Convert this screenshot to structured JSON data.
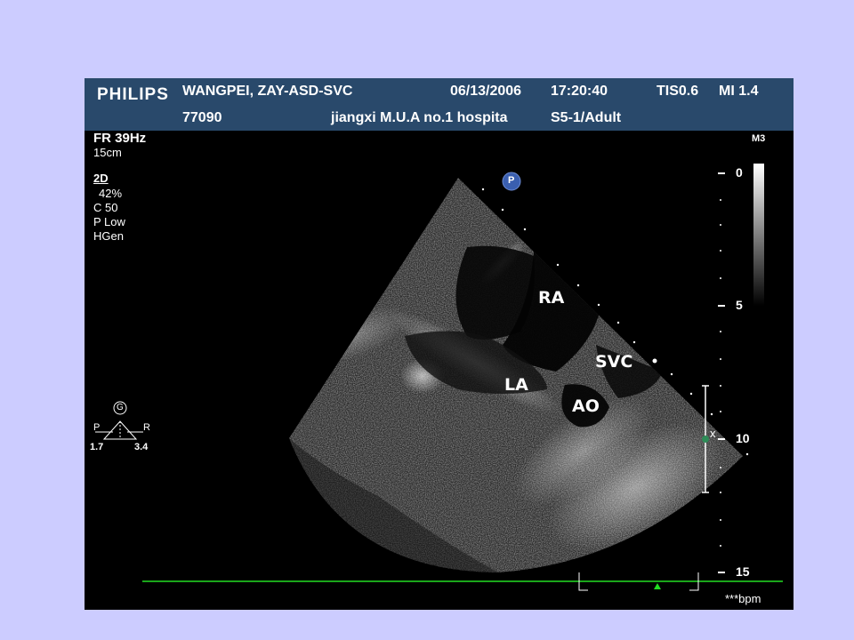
{
  "header": {
    "brand": "PHILIPS",
    "patient": "WANGPEI, ZAY-ASD-SVC",
    "date": "06/13/2006",
    "time": "17:20:40",
    "tis": "TIS0.6",
    "mi": "MI 1.4",
    "id": "77090",
    "hospital": "jiangxi M.U.A no.1 hospita",
    "probe": "S5-1/Adult"
  },
  "settings": {
    "frame_rate": "FR 39Hz",
    "depth": "15cm",
    "mode": "2D",
    "gain": "42%",
    "compress": "C 50",
    "power": "P Low",
    "freq": "HGen"
  },
  "map": "M3",
  "depth_scale": {
    "t0": "0",
    "t5": "5",
    "t10": "10",
    "t15": "15"
  },
  "labels": {
    "ra": "RA",
    "la": "LA",
    "svc": "SVC",
    "ao": "AO"
  },
  "markers": {
    "p": "P",
    "x": "x"
  },
  "orientation": {
    "g": "G",
    "p": "P",
    "r": "R",
    "left_val": "1.7",
    "right_val": "3.4"
  },
  "bpm": "***bpm",
  "colors": {
    "header_bg": "#29496b",
    "page_bg": "#ccccff",
    "ecg": "#22dd22",
    "marker": "#3a5fb0"
  }
}
